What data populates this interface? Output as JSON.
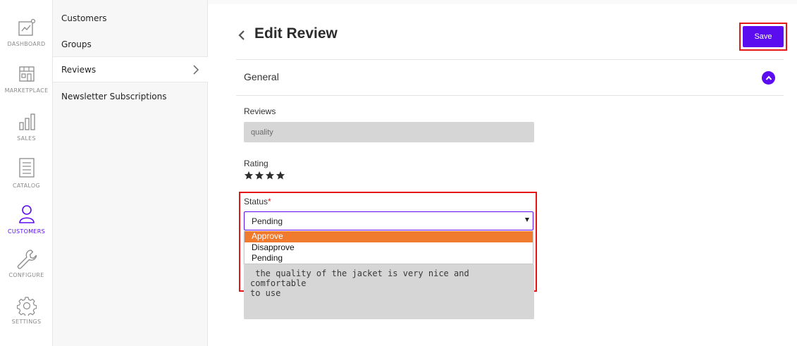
{
  "rail": {
    "items": [
      {
        "label": "DASHBOARD",
        "icon": "dashboard-icon"
      },
      {
        "label": "MARKETPLACE",
        "icon": "marketplace-icon"
      },
      {
        "label": "SALES",
        "icon": "sales-icon"
      },
      {
        "label": "CATALOG",
        "icon": "catalog-icon"
      },
      {
        "label": "CUSTOMERS",
        "icon": "customers-icon",
        "active": true
      },
      {
        "label": "CONFIGURE",
        "icon": "wrench-icon"
      },
      {
        "label": "SETTINGS",
        "icon": "gear-icon"
      }
    ]
  },
  "submenu": {
    "items": [
      {
        "label": "Customers"
      },
      {
        "label": "Groups"
      },
      {
        "label": "Reviews",
        "active": true
      },
      {
        "label": "Newsletter Subscriptions"
      }
    ]
  },
  "header": {
    "title": "Edit Review",
    "save_label": "Save"
  },
  "section": {
    "title": "General"
  },
  "form": {
    "reviews_label": "Reviews",
    "reviews_value": "quality",
    "rating_label": "Rating",
    "rating": 4,
    "status_label": "Status",
    "status_required": "*",
    "status_selected": "Pending",
    "status_options": [
      "Approve",
      "Disapprove",
      "Pending"
    ],
    "status_hovered": "Approve",
    "comment": " the quality of the jacket is very nice and comfortable\nto use"
  },
  "colors": {
    "accent": "#5b0df0",
    "highlight": "#e61616",
    "option_hover": "#f07a2e"
  }
}
